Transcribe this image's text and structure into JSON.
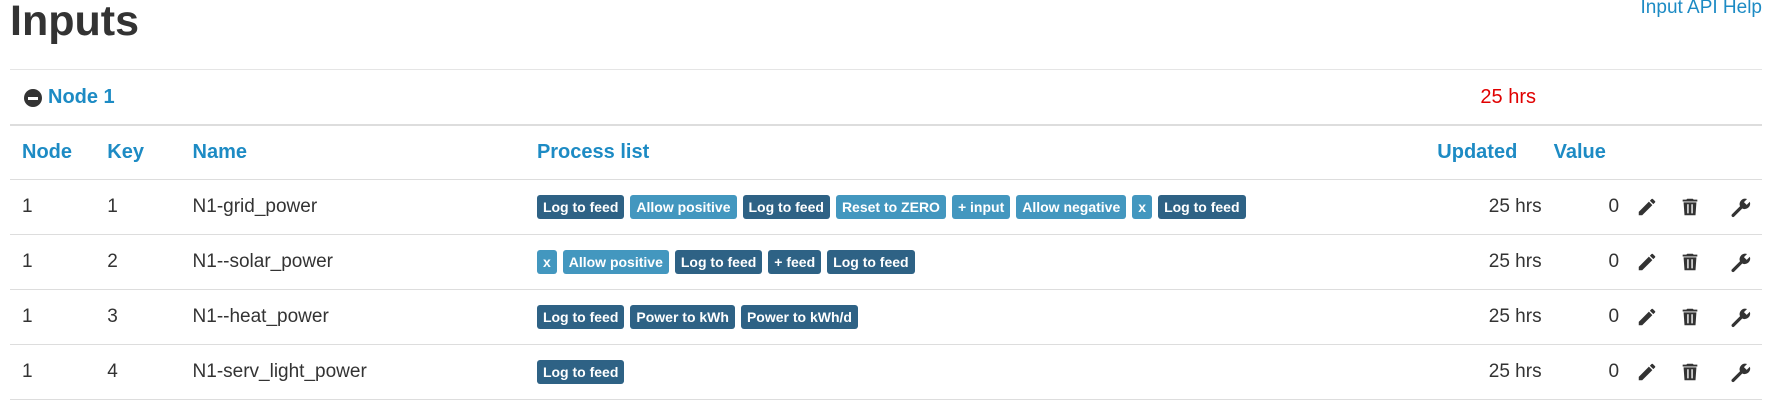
{
  "page": {
    "title": "Inputs",
    "help_link": "Input API Help"
  },
  "node_group": {
    "name": "Node 1",
    "updated": "25 hrs"
  },
  "table": {
    "headers": {
      "node": "Node",
      "key": "Key",
      "name": "Name",
      "process_list": "Process list",
      "updated": "Updated",
      "value": "Value"
    },
    "rows": [
      {
        "node": "1",
        "key": "1",
        "name": "N1-grid_power",
        "processes": [
          {
            "label": "Log to feed",
            "style": "dark"
          },
          {
            "label": "Allow positive",
            "style": "light"
          },
          {
            "label": "Log to feed",
            "style": "dark"
          },
          {
            "label": "Reset to ZERO",
            "style": "light"
          },
          {
            "label": "+ input",
            "style": "light"
          },
          {
            "label": "Allow negative",
            "style": "light"
          },
          {
            "label": "x",
            "style": "light"
          },
          {
            "label": "Log to feed",
            "style": "dark"
          }
        ],
        "updated": "25 hrs",
        "value": "0"
      },
      {
        "node": "1",
        "key": "2",
        "name": "N1--solar_power",
        "processes": [
          {
            "label": "x",
            "style": "light"
          },
          {
            "label": "Allow positive",
            "style": "light"
          },
          {
            "label": "Log to feed",
            "style": "dark"
          },
          {
            "label": "+ feed",
            "style": "dark"
          },
          {
            "label": "Log to feed",
            "style": "dark"
          }
        ],
        "updated": "25 hrs",
        "value": "0"
      },
      {
        "node": "1",
        "key": "3",
        "name": "N1--heat_power",
        "processes": [
          {
            "label": "Log to feed",
            "style": "dark"
          },
          {
            "label": "Power to kWh",
            "style": "dark"
          },
          {
            "label": "Power to kWh/d",
            "style": "dark"
          }
        ],
        "updated": "25 hrs",
        "value": "0"
      },
      {
        "node": "1",
        "key": "4",
        "name": "N1-serv_light_power",
        "processes": [
          {
            "label": "Log to feed",
            "style": "dark"
          }
        ],
        "updated": "25 hrs",
        "value": "0"
      }
    ]
  },
  "icons": {
    "collapse": "minus-circle-icon",
    "edit": "pencil-icon",
    "delete": "trash-icon",
    "config": "wrench-icon"
  },
  "colors": {
    "link": "#1d8bc4",
    "updated_stale": "#e00000",
    "badge_dark": "#2e6285",
    "badge_light": "#4397bf"
  }
}
